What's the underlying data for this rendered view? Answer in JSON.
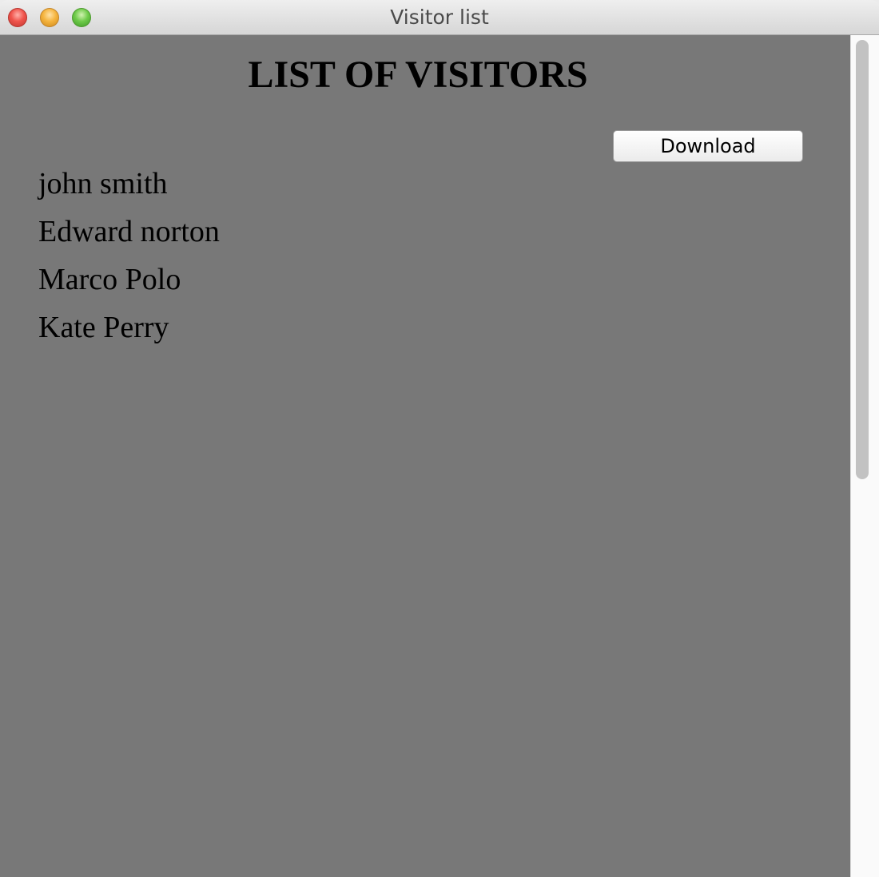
{
  "window": {
    "title": "Visitor list"
  },
  "page": {
    "heading": "LIST OF VISITORS",
    "download_label": "Download",
    "visitors": [
      "john smith",
      "Edward norton",
      "Marco Polo",
      "Kate Perry"
    ]
  },
  "colors": {
    "content_background": "#787878",
    "text": "#000000"
  },
  "icons": {
    "close": "close-icon",
    "minimize": "minimize-icon",
    "zoom": "zoom-icon"
  },
  "scroll": {
    "position_fraction": 0.0,
    "visible_fraction": 0.52
  }
}
